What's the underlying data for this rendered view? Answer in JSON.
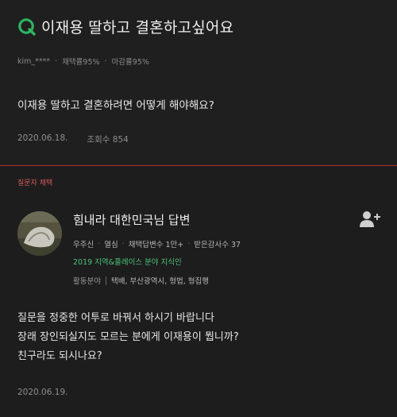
{
  "question": {
    "title": "이재용 딸하고 결혼하고싶어요",
    "author": "kim_****",
    "adopt_rate": "채택률95%",
    "close_rate": "마감률95%",
    "body": "이재용 딸하고 결혼하려면 어떻게 해야해요?",
    "date": "2020.06.18.",
    "views": "조회수 854"
  },
  "answer": {
    "chosen_label": "질문자 채택",
    "name": "힘내라 대한민국님 답변",
    "rank": "우주신",
    "status": "열심",
    "adopted_count": "채택답변수 1만+",
    "thanks": "받은감사수 37",
    "expert": "2019 지역&플레이스 분야 지식인",
    "area_label": "활동분야",
    "area_value": "택배, 부산광역시, 형법, 형집행",
    "body_lines": [
      "질문을 정중한 어투로 바꿔서 하시기 바랍니다",
      "장래 장인되실지도 모르는 분에게 이재용이 뭡니까?",
      "친구라도 되시나요?"
    ],
    "date": "2020.06.19."
  },
  "colors": {
    "accent_green": "#2db563",
    "divider_red": "#b03030",
    "chosen_red": "#d85a5a"
  },
  "icons": {
    "q_badge": "q-icon",
    "follow": "add-user-icon"
  }
}
